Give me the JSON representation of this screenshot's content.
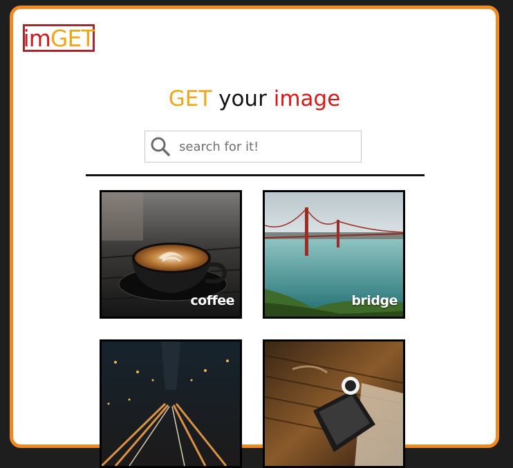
{
  "logo": {
    "part1": "im",
    "part2": "GET"
  },
  "headline": {
    "word1": "GET",
    "word2": "your",
    "word3": "image"
  },
  "search": {
    "placeholder": "search for it!",
    "value": ""
  },
  "tiles": [
    {
      "label": "coffee"
    },
    {
      "label": "bridge"
    },
    {
      "label": ""
    },
    {
      "label": ""
    }
  ],
  "colors": {
    "frame_border": "#ef8a23",
    "brand_red": "#d11a1a",
    "brand_orange": "#f2a516",
    "logo_border": "#a4282d",
    "page_background": "#1e1e1e"
  },
  "icons": {
    "search": "search-icon"
  }
}
